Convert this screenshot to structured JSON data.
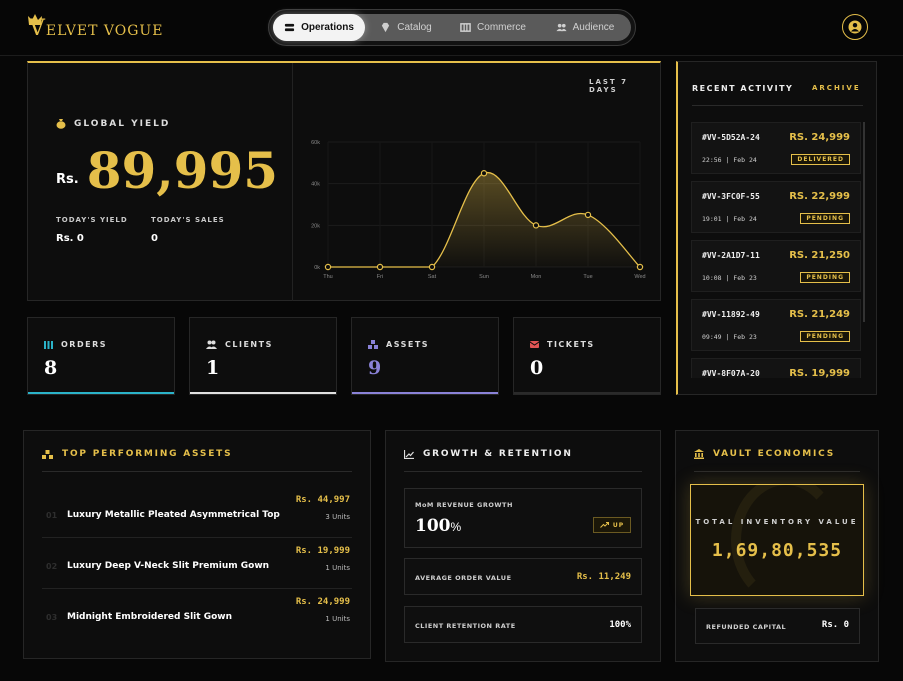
{
  "brand": {
    "logo_initial": "V",
    "logo_rest": "ELVET VOGUE"
  },
  "nav": {
    "tabs": [
      {
        "label": "Operations",
        "icon": "layers-icon",
        "active": true
      },
      {
        "label": "Catalog",
        "icon": "gem-icon",
        "active": false
      },
      {
        "label": "Commerce",
        "icon": "grid-icon",
        "active": false
      },
      {
        "label": "Audience",
        "icon": "users-icon",
        "active": false
      }
    ]
  },
  "user_icon": "user-icon",
  "yield": {
    "title": "GLOBAL YIELD",
    "currency": "Rs.",
    "value": "89,995",
    "todays_yield_label": "TODAY'S YIELD",
    "todays_yield_value": "Rs. 0",
    "todays_sales_label": "TODAY'S SALES",
    "todays_sales_value": "0",
    "range_label": "LAST 7 DAYS"
  },
  "chart_data": {
    "type": "area",
    "categories": [
      "Thu",
      "Fri",
      "Sat",
      "Sun",
      "Mon",
      "Tue",
      "Wed"
    ],
    "values": [
      0,
      0,
      0,
      45000,
      20000,
      25000,
      0
    ],
    "yticks": [
      "0k",
      "20k",
      "40k",
      "60k"
    ],
    "ylim": [
      0,
      60000
    ],
    "grid": true,
    "color": "#e5bf4a"
  },
  "activity": {
    "title": "RECENT ACTIVITY",
    "archive_label": "ARCHIVE",
    "items": [
      {
        "id": "#VV-5D52A-24",
        "amount": "RS. 24,999",
        "time": "22:56 | Feb 24",
        "status": "DELIVERED"
      },
      {
        "id": "#VV-3FC0F-55",
        "amount": "RS. 22,999",
        "time": "19:01 | Feb 24",
        "status": "PENDING"
      },
      {
        "id": "#VV-2A1D7-11",
        "amount": "RS. 21,250",
        "time": "10:08 | Feb 23",
        "status": "PENDING"
      },
      {
        "id": "#VV-11892-49",
        "amount": "RS. 21,249",
        "time": "09:49 | Feb 23",
        "status": "PENDING"
      },
      {
        "id": "#VV-8F07A-20",
        "amount": "RS. 19,999",
        "time": "",
        "status": ""
      }
    ]
  },
  "stats": [
    {
      "label": "ORDERS",
      "value": "8",
      "color": "#2bb3c9"
    },
    {
      "label": "CLIENTS",
      "value": "1",
      "color": "#e0e0e0"
    },
    {
      "label": "ASSETS",
      "value": "9",
      "color": "#8a82d8"
    },
    {
      "label": "TICKETS",
      "value": "0",
      "color": "#e05555"
    }
  ],
  "top_assets": {
    "title": "TOP PERFORMING ASSETS",
    "items": [
      {
        "rank": "01",
        "name": "Luxury Metallic Pleated Asymmetrical Top",
        "price": "Rs. 44,997",
        "units": "3 Units"
      },
      {
        "rank": "02",
        "name": "Luxury Deep V-Neck Slit Premium Gown",
        "price": "Rs. 19,999",
        "units": "1 Units"
      },
      {
        "rank": "03",
        "name": "Midnight Embroidered Slit Gown",
        "price": "Rs. 24,999",
        "units": "1 Units"
      }
    ]
  },
  "growth": {
    "title": "GROWTH & RETENTION",
    "mom_label": "MoM REVENUE GROWTH",
    "mom_value": "100",
    "mom_unit": "%",
    "up_label": "UP",
    "aov_label": "AVERAGE ORDER VALUE",
    "aov_value": "Rs. 11,249",
    "retention_label": "CLIENT RETENTION RATE",
    "retention_value": "100%"
  },
  "vault": {
    "title": "VAULT ECONOMICS",
    "tiv_label": "TOTAL INVENTORY VALUE",
    "tiv_value": "1,69,80,535",
    "refund_label": "REFUNDED CAPITAL",
    "refund_value": "Rs. 0"
  }
}
